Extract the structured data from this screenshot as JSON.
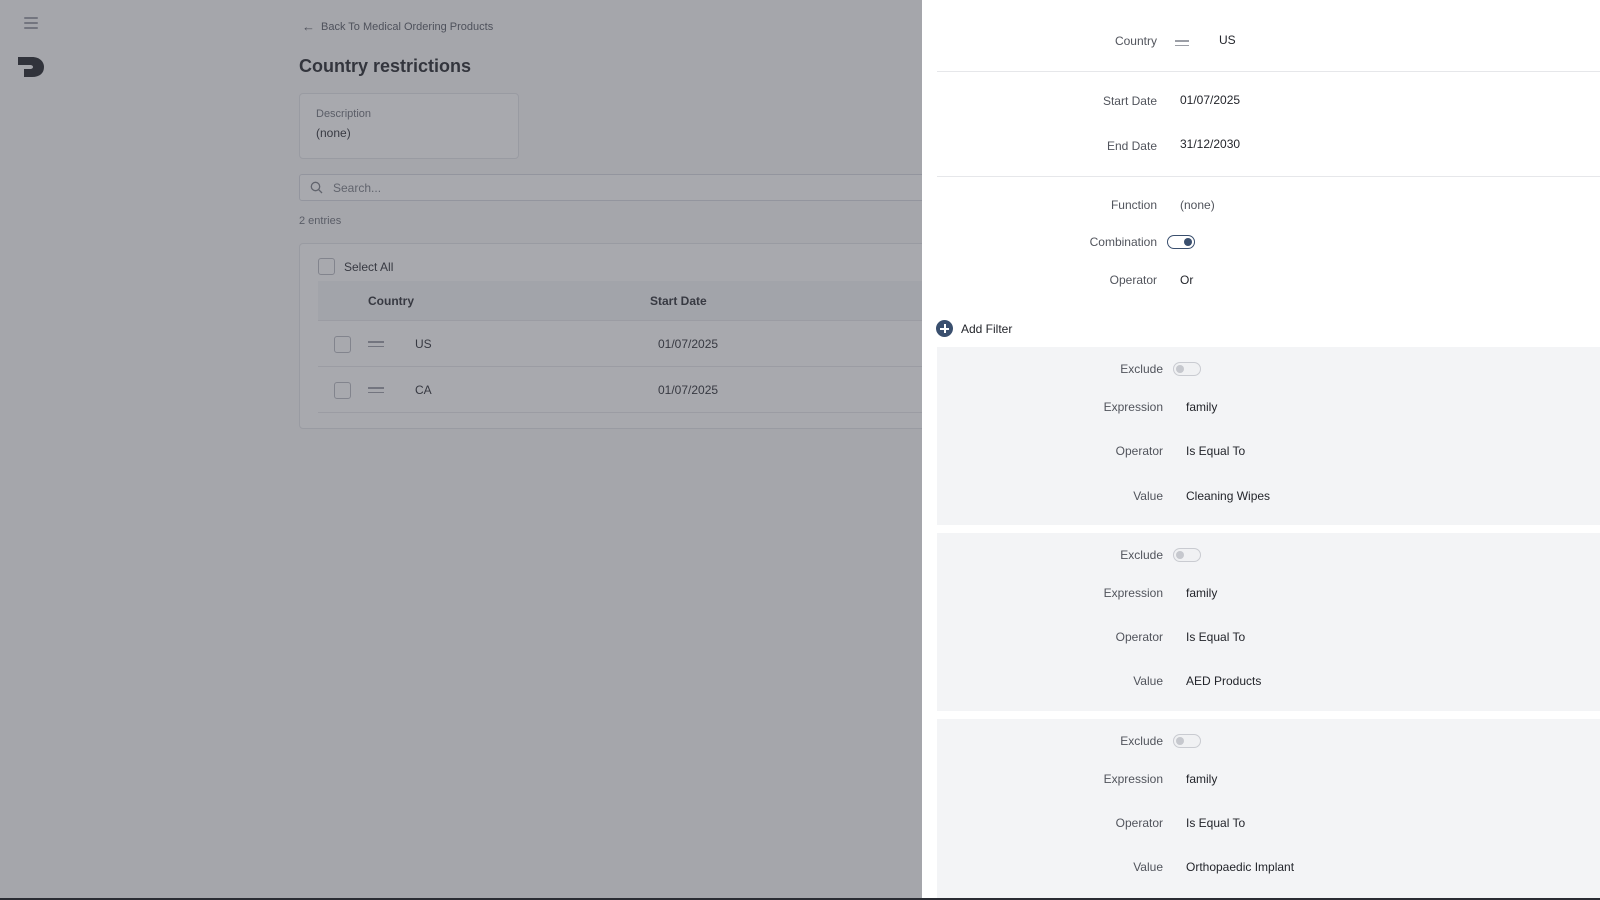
{
  "nav": {
    "back_label": "Back To Medical Ordering Products"
  },
  "page": {
    "title": "Country restrictions"
  },
  "description": {
    "label": "Description",
    "value": "(none)"
  },
  "search": {
    "placeholder": "Search..."
  },
  "table": {
    "entries_label": "2 entries",
    "select_all_label": "Select All",
    "columns": [
      "Country",
      "Start Date"
    ],
    "rows": [
      {
        "country": "US",
        "start_date": "01/07/2025"
      },
      {
        "country": "CA",
        "start_date": "01/07/2025"
      }
    ]
  },
  "drawer": {
    "country": {
      "label": "Country",
      "value": "US"
    },
    "start_date": {
      "label": "Start Date",
      "value": "01/07/2025"
    },
    "end_date": {
      "label": "End Date",
      "value": "31/12/2030"
    },
    "function": {
      "label": "Function",
      "value": "(none)"
    },
    "combination": {
      "label": "Combination",
      "enabled": true
    },
    "operator": {
      "label": "Operator",
      "value": "Or"
    },
    "add_filter_label": "Add Filter",
    "filters": [
      {
        "exclude_label": "Exclude",
        "exclude": false,
        "expression_label": "Expression",
        "expression": "family",
        "operator_label": "Operator",
        "operator": "Is Equal To",
        "value_label": "Value",
        "value": "Cleaning Wipes"
      },
      {
        "exclude_label": "Exclude",
        "exclude": false,
        "expression_label": "Expression",
        "expression": "family",
        "operator_label": "Operator",
        "operator": "Is Equal To",
        "value_label": "Value",
        "value": "AED Products"
      },
      {
        "exclude_label": "Exclude",
        "exclude": false,
        "expression_label": "Expression",
        "expression": "family",
        "operator_label": "Operator",
        "operator": "Is Equal To",
        "value_label": "Value",
        "value": "Orthopaedic Implant"
      }
    ]
  },
  "colors": {
    "accent": "#3a4f6e",
    "overlay": "#464852",
    "panel_bg": "#f3f4f6"
  },
  "icons": [
    "menu-icon",
    "logo-icon",
    "arrow-left-icon",
    "search-icon",
    "drag-handle-icon",
    "equals-icon",
    "plus-circle-icon"
  ]
}
